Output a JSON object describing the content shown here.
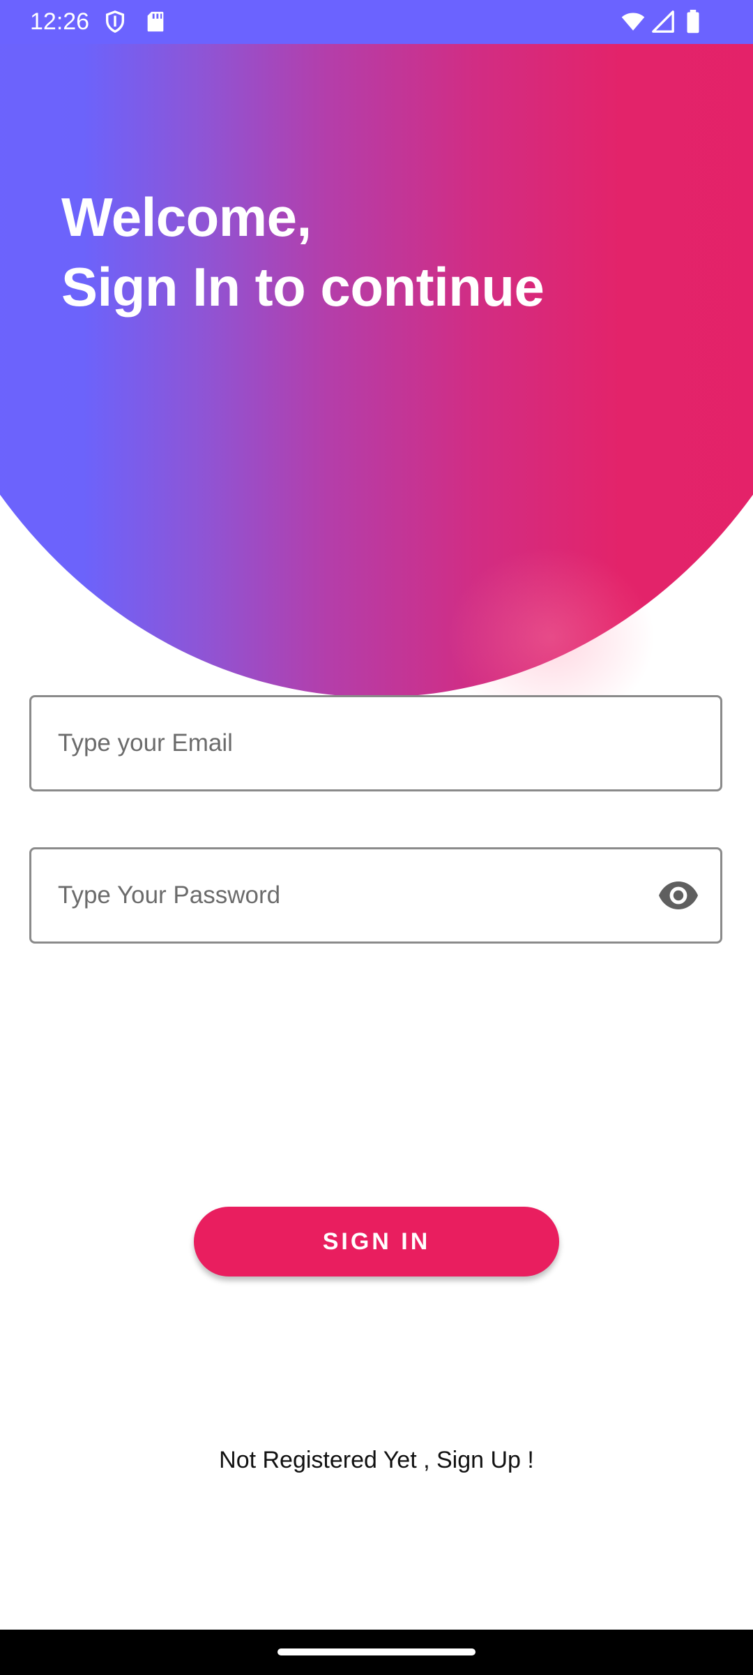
{
  "status_bar": {
    "time": "12:26",
    "left_icons": [
      "shield-icon",
      "sd-card-icon"
    ],
    "right_icons": [
      "wifi-icon",
      "signal-icon",
      "battery-icon"
    ],
    "background": "#6b63ff"
  },
  "hero": {
    "title_line1": "Welcome,",
    "title_line2": "Sign In to continue",
    "gradient_start": "#6b63ff",
    "gradient_end": "#e42268"
  },
  "form": {
    "email_placeholder": "Type your Email",
    "email_value": "",
    "password_placeholder": "Type Your Password",
    "password_value": "",
    "password_toggle_icon": "eye-icon"
  },
  "actions": {
    "sign_in_label": "SIGN IN",
    "sign_in_color": "#e91e5f",
    "signup_text": "Not Registered Yet , Sign Up !"
  }
}
